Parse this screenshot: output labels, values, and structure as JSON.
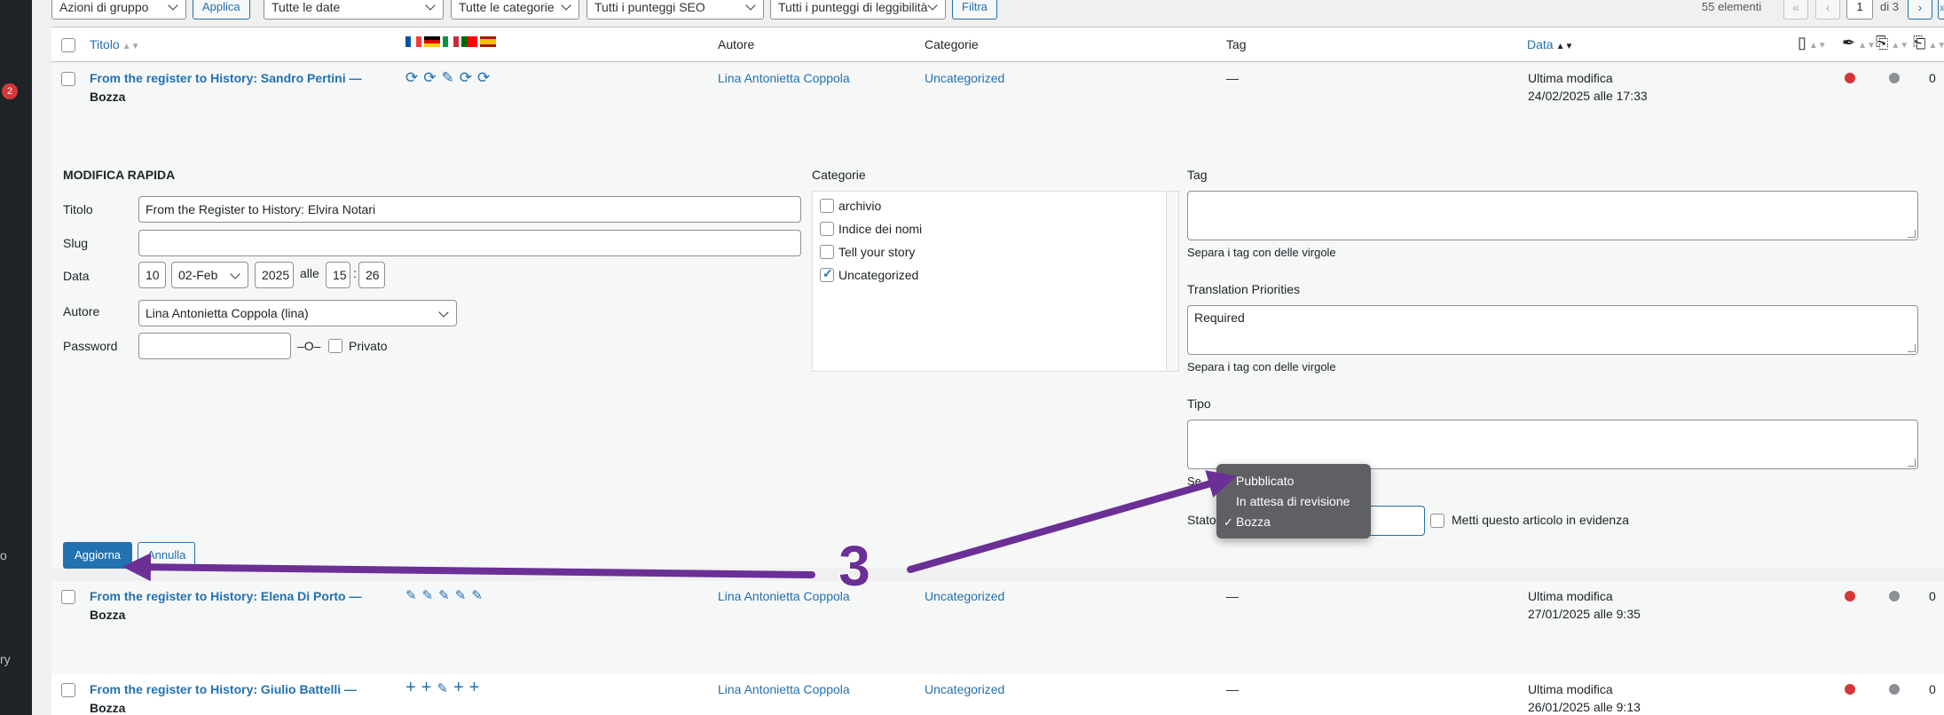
{
  "sidebar": {
    "badge": "2",
    "frag1": "o",
    "frag2": "ry"
  },
  "filterbar": {
    "bulk_actions": "Azioni di gruppo",
    "apply": "Applica",
    "dates": "Tutte le date",
    "categories": "Tutte le categorie",
    "seo": "Tutti i punteggi SEO",
    "readability": "Tutti i punteggi di leggibilità",
    "filter": "Filtra",
    "count": "55 elementi",
    "first": "«",
    "prev": "‹",
    "page": "1",
    "of": "di 3",
    "next": "›",
    "last": "»"
  },
  "columns": {
    "title": "Titolo",
    "author": "Autore",
    "categories": "Categorie",
    "tag": "Tag",
    "date": "Data"
  },
  "rows": [
    {
      "title": "From the register to History: Sandro Pertini",
      "state": "Bozza",
      "author": "Lina Antonietta Coppola",
      "category": "Uncategorized",
      "tag": "—",
      "date_label": "Ultima modifica",
      "date": "24/02/2025 alle 17:33",
      "count": "0"
    },
    {
      "title": "From the register to History: Elena Di Porto",
      "state": "Bozza",
      "author": "Lina Antonietta Coppola",
      "category": "Uncategorized",
      "tag": "—",
      "date_label": "Ultima modifica",
      "date": "27/01/2025 alle 9:35",
      "count": "0"
    },
    {
      "title": "From the register to History: Giulio Battelli",
      "state": "Bozza",
      "author": "Lina Antonietta Coppola",
      "category": "Uncategorized",
      "tag": "—",
      "date_label": "Ultima modifica",
      "date": "26/01/2025 alle 9:13",
      "count": "0"
    }
  ],
  "quick_edit": {
    "heading": "MODIFICA RAPIDA",
    "title_label": "Titolo",
    "title_value": "From the Register to History: Elvira Notari",
    "slug_label": "Slug",
    "slug_value": "",
    "date_label": "Data",
    "day": "10",
    "month": "02-Feb",
    "year": "2025",
    "at": "alle",
    "hour": "15",
    "colon": ":",
    "minute": "26",
    "author_label": "Autore",
    "author_value": "Lina Antonietta Coppola (lina)",
    "password_label": "Password",
    "password_value": "",
    "or": "–O–",
    "private": "Privato",
    "categories_label": "Categorie",
    "categories": [
      {
        "name": "archivio",
        "checked": false
      },
      {
        "name": "Indice dei nomi",
        "checked": false
      },
      {
        "name": "Tell your story",
        "checked": false
      },
      {
        "name": "Uncategorized",
        "checked": true
      }
    ],
    "tag_label": "Tag",
    "tag_hint": "Separa i tag con delle virgole",
    "priorities_label": "Translation Priorities",
    "priorities_value": "Required",
    "priorities_hint": "Separa i tag con delle virgole",
    "type_label": "Tipo",
    "type_hint_fragment": "Se",
    "status_label": "Stato",
    "sticky_label": "Metti questo articolo in evidenza",
    "status_options": [
      "Pubblicato",
      "In attesa di revisione",
      "Bozza"
    ],
    "status_selected": "Bozza",
    "update_button": "Aggiorna",
    "cancel_button": "Annulla"
  },
  "annotation": {
    "step": "3",
    "color": "#6b2f96"
  },
  "colors": {
    "accent": "#2271b1",
    "red_dot": "#d63638",
    "grey_dot": "#8c8f94"
  }
}
